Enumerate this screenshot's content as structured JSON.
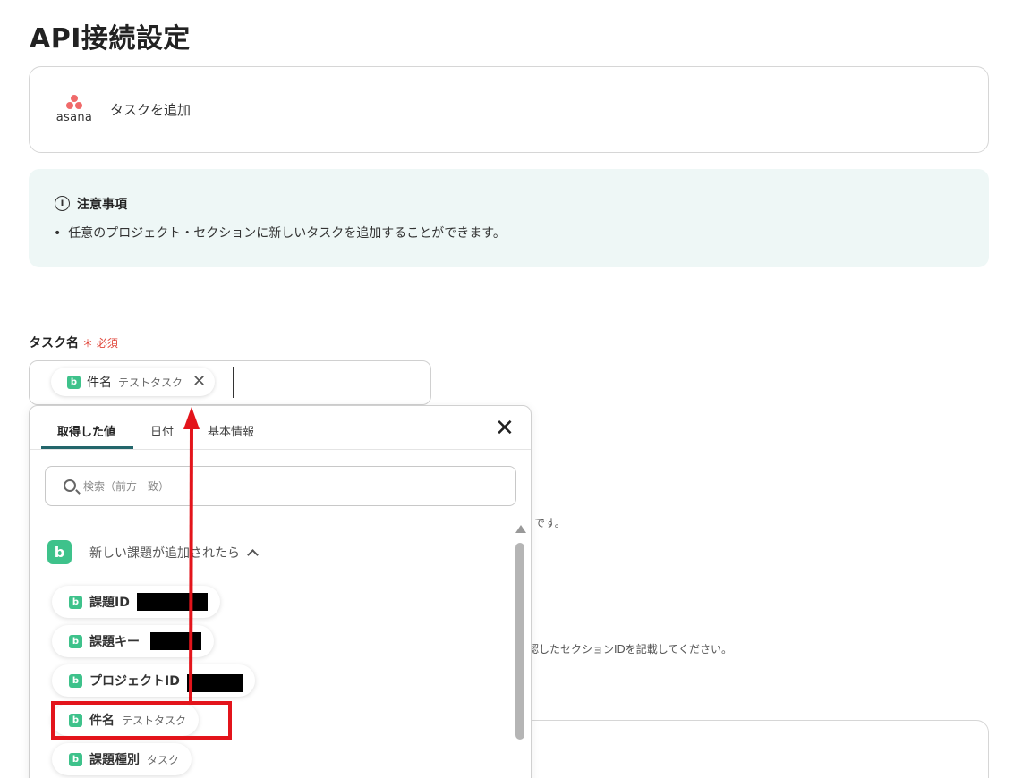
{
  "page_title": "API接続設定",
  "app_card": {
    "app_name": "asana",
    "action": "タスクを追加"
  },
  "notice": {
    "icon": "info-icon",
    "title": "注意事項",
    "bullet": "任意のプロジェクト・セクションに新しいタスクを追加することができます。"
  },
  "task_field": {
    "label": "タスク名",
    "required_label": "必須",
    "token": {
      "name": "件名",
      "value": "テストタスク"
    }
  },
  "background_hints": {
    "text1": "です。",
    "text2": "認したセクションIDを記載してください。"
  },
  "popup": {
    "tabs": [
      "取得した値",
      "日付",
      "基本情報"
    ],
    "active_tab": "取得した値",
    "search_placeholder": "検索（前方一致）",
    "group": {
      "label": "新しい課題が追加されたら",
      "icon": "backlog-icon"
    },
    "items": [
      {
        "name": "課題ID",
        "value": "",
        "redacted": true
      },
      {
        "name": "課題キー",
        "value": "",
        "redacted": true
      },
      {
        "name": "プロジェクトID",
        "value": "",
        "redacted": true
      },
      {
        "name": "件名",
        "value": "テストタスク",
        "highlighted": true
      },
      {
        "name": "課題種別",
        "value": "タスク"
      }
    ]
  },
  "colors": {
    "accent": "#23666b",
    "backlog_green": "#3ec28b",
    "highlight_red": "#e3141b",
    "asana_pink": "#f06a6a"
  }
}
